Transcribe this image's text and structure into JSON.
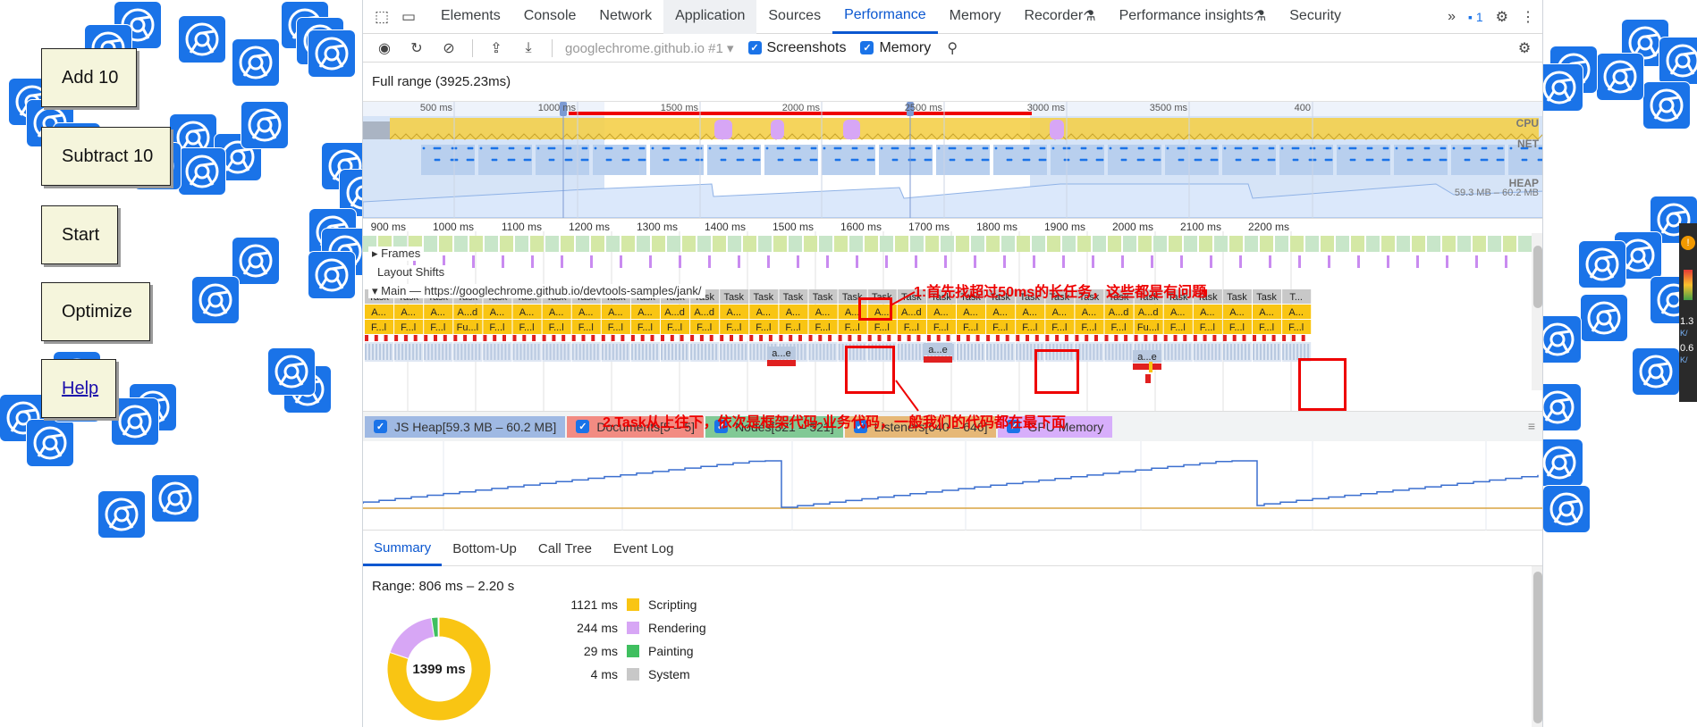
{
  "page": {
    "buttons": [
      "Add 10",
      "Subtract 10",
      "Start",
      "Optimize",
      "Help"
    ]
  },
  "devtools": {
    "tabs": [
      "Elements",
      "Console",
      "Network",
      "Application",
      "Sources",
      "Performance",
      "Memory",
      "Recorder",
      "Performance insights",
      "Security"
    ],
    "selected_tab": "Performance",
    "issues_count": "1",
    "toolbar": {
      "target": "googlechrome.github.io #1",
      "screenshots_label": "Screenshots",
      "memory_label": "Memory"
    },
    "full_range": "Full range (3925.23ms)",
    "overview": {
      "ticks": [
        "500 ms",
        "1000 ms",
        "1500 ms",
        "2000 ms",
        "2500 ms",
        "3000 ms",
        "3500 ms",
        "400"
      ],
      "cpu_label": "CPU",
      "net_label": "NET",
      "heap_label": "HEAP",
      "heap_range": "59.3 MB – 60.2 MB"
    },
    "timeline": {
      "ticks": [
        "900 ms",
        "1000 ms",
        "1100 ms",
        "1200 ms",
        "1300 ms",
        "1400 ms",
        "1500 ms",
        "1600 ms",
        "1700 ms",
        "1800 ms",
        "1900 ms",
        "2000 ms",
        "2100 ms",
        "2200 ms"
      ],
      "frames_label": "Frames",
      "layout_shifts_label": "Layout Shifts",
      "main_label": "Main — https://googlechrome.github.io/devtools-samples/jank/",
      "task_label": "Task",
      "task_last": "T...",
      "row2": [
        "A...",
        "A...",
        "A...",
        "A...d",
        "A...",
        "A...",
        "A...",
        "A...",
        "A...",
        "A...",
        "A...d",
        "A...d",
        "A...",
        "A...",
        "A...",
        "A...",
        "A...",
        "A...",
        "A...d",
        "A...",
        "A...",
        "A...",
        "A...",
        "A...",
        "A...",
        "A...d",
        "A...d",
        "A...",
        "A...",
        "A...",
        "A...",
        "A..."
      ],
      "row3": [
        "F...l",
        "F...l",
        "F...l",
        "Fu...l",
        "F...l",
        "F...l",
        "F...l",
        "F...l",
        "F...l",
        "F...l",
        "F...l",
        "F...l",
        "F...l",
        "F...l",
        "F...l",
        "F...l",
        "F...l",
        "F...l",
        "F...l",
        "F...l",
        "F...l",
        "F...l",
        "F...l",
        "F...l",
        "F...l",
        "F...l",
        "Fu...l",
        "F...l",
        "F...l",
        "F...l",
        "F...l",
        "F...l"
      ],
      "ae_label": "a...e"
    },
    "memory_legend": [
      {
        "label": "JS Heap[59.3 MB – 60.2 MB]",
        "color": "#9fb9e3"
      },
      {
        "label": "Documents[5 – 5]",
        "color": "#f28b82"
      },
      {
        "label": "Nodes[321 – 521]",
        "color": "#81c995"
      },
      {
        "label": "Listeners[640 – 646]",
        "color": "#e6b877"
      },
      {
        "label": "GPU Memory",
        "color": "#d7aefb"
      }
    ],
    "bottom_tabs": [
      "Summary",
      "Bottom-Up",
      "Call Tree",
      "Event Log"
    ],
    "summary": {
      "range": "Range: 806 ms – 2.20 s",
      "total": "1399 ms",
      "rows": [
        {
          "value": "1121 ms",
          "label": "Scripting",
          "color": "#f9c513"
        },
        {
          "value": "244 ms",
          "label": "Rendering",
          "color": "#d7a6f5"
        },
        {
          "value": "29 ms",
          "label": "Painting",
          "color": "#3fbf5f"
        },
        {
          "value": "4 ms",
          "label": "System",
          "color": "#c8c8c8"
        }
      ]
    }
  },
  "annotations": {
    "note1": "1:首先找超过50ms的长任务，这些都是有问题",
    "note2": "2.Task从上往下，依次是框架代码-业务代码，一般我们的代码都在最下面"
  },
  "right_edge": {
    "v1": "1.3",
    "v2": "0.6",
    "u1": "K/",
    "u2": "K/"
  }
}
